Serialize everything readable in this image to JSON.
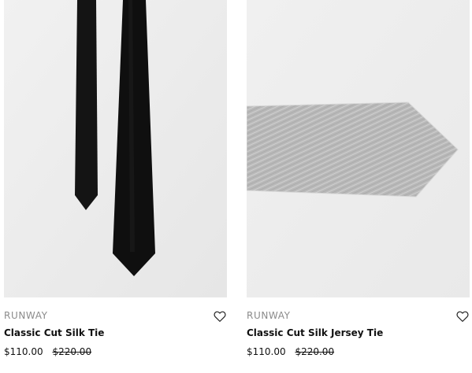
{
  "products": [
    {
      "brand": "RUNWAY",
      "title": "Classic Cut Silk Tie",
      "price_current": "$110.00",
      "price_original": "$220.00",
      "image_desc_icon": "black-silk-tie-image",
      "wishlist_icon": "heart-outline-icon"
    },
    {
      "brand": "RUNWAY",
      "title": "Classic Cut Silk Jersey Tie",
      "price_current": "$110.00",
      "price_original": "$220.00",
      "image_desc_icon": "grey-jersey-tie-image",
      "wishlist_icon": "heart-outline-icon"
    }
  ],
  "colors": {
    "image_bg": "#ececec",
    "tie_black": "#111111",
    "tie_grey": "#b8b8b8",
    "brand_text": "#8b8b8b"
  }
}
